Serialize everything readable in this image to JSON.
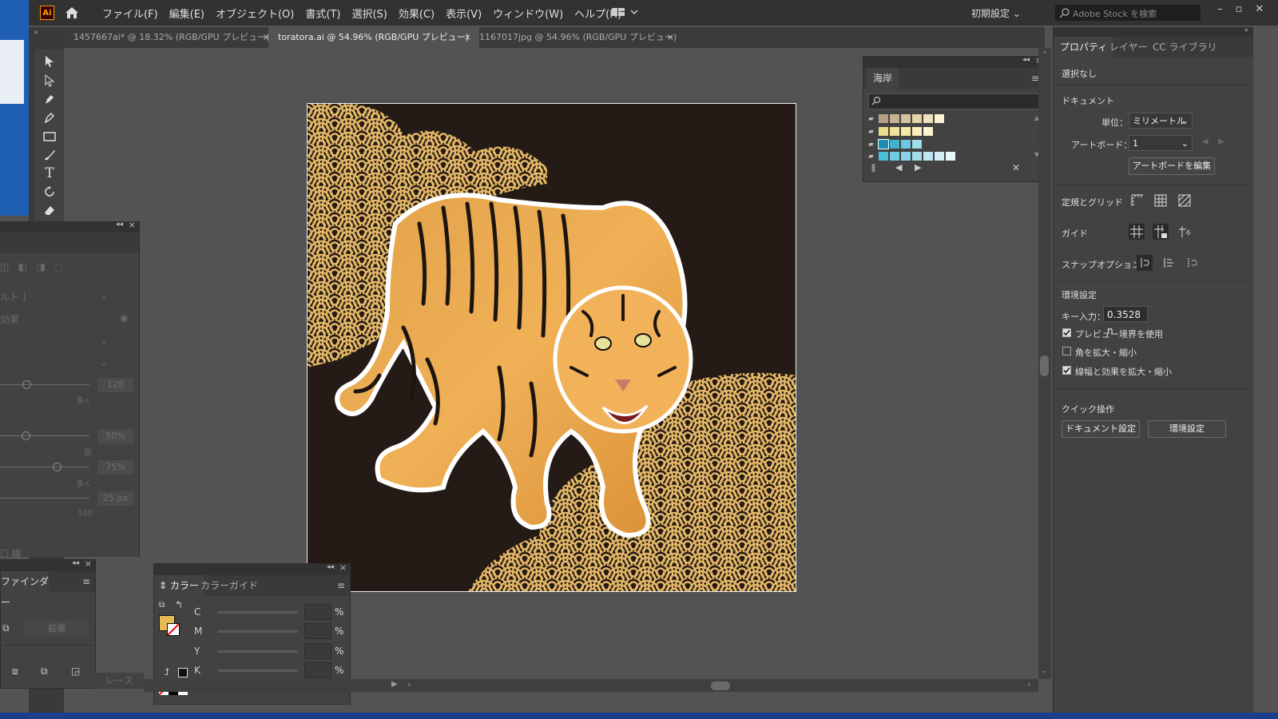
{
  "app": {
    "logo": "Ai"
  },
  "menu": [
    "ファイル(F)",
    "編集(E)",
    "オブジェクト(O)",
    "書式(T)",
    "選択(S)",
    "効果(C)",
    "表示(V)",
    "ウィンドウ(W)",
    "ヘルプ(H)"
  ],
  "workspace": {
    "preset": "初期設定",
    "search_placeholder": "Adobe Stock を検索"
  },
  "tabs": [
    {
      "label": "1457667ai* @ 18.32% (RGB/GPU プレビュー)",
      "active": false
    },
    {
      "label": "toratora.ai @ 54.96% (RGB/GPU プレビュー)",
      "active": true
    },
    {
      "label": "1167017jpg @ 54.96% (RGB/GPU プレビュー)",
      "active": false
    }
  ],
  "tools": [
    "selection-tool",
    "direct-selection-tool",
    "pen-tool",
    "curvature-tool",
    "rectangle-tool",
    "paintbrush-tool",
    "type-tool",
    "rotate-tool",
    "eraser-tool"
  ],
  "swatches_panel": {
    "title": "海岸",
    "rows": [
      [
        "#b59f85",
        "#c9b28f",
        "#d6c39b",
        "#e2d3a8",
        "#efe3bd",
        "#fbf2d4"
      ],
      [
        "#efdc8b",
        "#f3e398",
        "#f6e9a8",
        "#f8efbb",
        "#fbf5d2"
      ],
      [
        "#1a8fb3",
        "#3fb2cf",
        "#6cc7dc",
        "#9fdbe8"
      ],
      [
        "#4bbfd6",
        "#6fcbe0",
        "#8ad4e6",
        "#a3dcea",
        "#bde6f0",
        "#d3eef5",
        "#e8f6fa"
      ]
    ]
  },
  "ghost_panel": {
    "dropdown1": "ルト ]",
    "dropdown2": "効果",
    "val1": "128",
    "hint1": "多く",
    "val2": "50%",
    "hint2": "高",
    "val3": "75%",
    "hint3": "多く",
    "val4": "25 px",
    "hint4": "100",
    "check": "線"
  },
  "pathfinder": {
    "title": "ファインダー",
    "expand": "拡張",
    "trace": "レース"
  },
  "color_panel": {
    "tab_color": "カラー",
    "tab_guide": "カラーガイド",
    "channels": [
      "C",
      "M",
      "Y",
      "K"
    ],
    "unit": "%",
    "fill": "#e8bb55"
  },
  "properties": {
    "tabs": [
      "プロパティ",
      "レイヤー",
      "CC ライブラリ"
    ],
    "selection": "選択なし",
    "document_heading": "ドキュメント",
    "unit_label": "単位：",
    "unit_value": "ミリメートル",
    "artboard_label": "アートボード：",
    "artboard_value": "1",
    "edit_artboard": "アートボードを編集",
    "rulers_grid": "定規とグリッド",
    "guides": "ガイド",
    "snap": "スナップオプション",
    "prefs_heading": "環境設定",
    "key_label": "キー入力：",
    "key_value": "0.3528 n",
    "cb1": "プレビュー境界を使用",
    "cb2": "角を拡大・縮小",
    "cb3": "線幅と効果を拡大・縮小",
    "quick": "クイック操作",
    "doc_settings": "ドキュメント設定",
    "env_settings": "環境設定"
  }
}
